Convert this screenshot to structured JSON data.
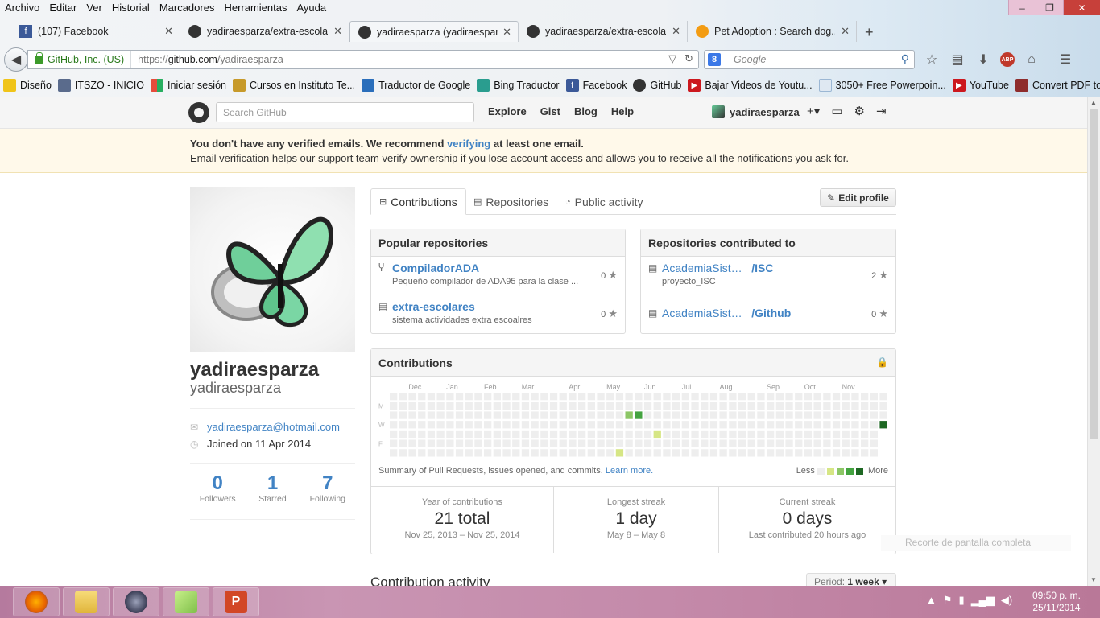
{
  "browser": {
    "menu": [
      "Archivo",
      "Editar",
      "Ver",
      "Historial",
      "Marcadores",
      "Herramientas",
      "Ayuda"
    ],
    "window_controls": [
      "–",
      "❐",
      "✕"
    ],
    "tabs": [
      {
        "title": "(107) Facebook",
        "icon": "facebook-icon",
        "color": "#3b5998"
      },
      {
        "title": "yadiraesparza/extra-escolar...",
        "icon": "github-icon",
        "color": "#333333"
      },
      {
        "title": "yadiraesparza (yadiraesparz...",
        "icon": "github-icon",
        "color": "#333333"
      },
      {
        "title": "yadiraesparza/extra-escolar...",
        "icon": "github-icon",
        "color": "#333333"
      },
      {
        "title": "Pet Adoption : Search dog...",
        "icon": "paw-icon",
        "color": "#f39c12"
      }
    ],
    "url_identity": "GitHub, Inc. (US)",
    "url_prefix": "https://",
    "url_host": "github.com",
    "url_path": "/yadiraesparza",
    "search_placeholder": "Google",
    "bookmarks": [
      {
        "label": "Diseño",
        "icon": "folder-icon",
        "color": "#f0c419"
      },
      {
        "label": "ITSZO - INICIO",
        "icon": "page-icon",
        "color": "#5a6b8c"
      },
      {
        "label": "Iniciar sesión",
        "icon": "windows-icon",
        "color": "#e74c3c"
      },
      {
        "label": "Cursos en Instituto Te...",
        "icon": "school-icon",
        "color": "#c79a2a"
      },
      {
        "label": "Traductor de Google",
        "icon": "translate-icon",
        "color": "#2a6ebb"
      },
      {
        "label": "Bing Traductor",
        "icon": "translate-icon",
        "color": "#2a9d8f"
      },
      {
        "label": "Facebook",
        "icon": "facebook-icon",
        "color": "#3b5998"
      },
      {
        "label": "GitHub",
        "icon": "github-icon",
        "color": "#333333"
      },
      {
        "label": "Bajar Videos de Youtu...",
        "icon": "youtube-icon",
        "color": "#cc181e"
      },
      {
        "label": "3050+ Free Powerpoin...",
        "icon": "page-icon",
        "color": "#9bb7d4"
      },
      {
        "label": "YouTube",
        "icon": "youtube-icon",
        "color": "#cc181e"
      },
      {
        "label": "Convert PDF to Word ...",
        "icon": "convert-icon",
        "color": "#8e2c2c"
      }
    ]
  },
  "github": {
    "search_placeholder": "Search GitHub",
    "nav": [
      "Explore",
      "Gist",
      "Blog",
      "Help"
    ],
    "username": "yadiraesparza",
    "flash": {
      "pre": "You don't have any verified emails. We recommend ",
      "link": "verifying",
      "post": " at least one email.",
      "line2": "Email verification helps our support team verify ownership if you lose account access and allows you to receive all the notifications you ask for."
    },
    "profile": {
      "fullname": "yadiraesparza",
      "username": "yadiraesparza",
      "email": "yadiraesparza@hotmail.com",
      "joined": "Joined on 11 Apr 2014",
      "stats": [
        {
          "num": "0",
          "label": "Followers"
        },
        {
          "num": "1",
          "label": "Starred"
        },
        {
          "num": "7",
          "label": "Following"
        }
      ]
    },
    "tabs": [
      "Contributions",
      "Repositories",
      "Public activity"
    ],
    "edit_profile": "Edit profile",
    "popular": {
      "title": "Popular repositories",
      "items": [
        {
          "name": "CompiladorADA",
          "desc": "Pequeño compilador de ADA95 para la clase ...",
          "stars": "0",
          "icon": "fork-icon"
        },
        {
          "name": "extra-escolares",
          "desc": "sistema actividades extra escoalres",
          "stars": "0",
          "icon": "repo-icon"
        }
      ]
    },
    "contributed": {
      "title": "Repositories contributed to",
      "items": [
        {
          "owner": "AcademiaSist…",
          "name": "/ISC",
          "desc": "proyecto_ISC",
          "stars": "2",
          "icon": "repo-icon"
        },
        {
          "owner": "AcademiaSist…",
          "name": "/Github",
          "desc": "",
          "stars": "0",
          "icon": "repo-icon"
        }
      ]
    },
    "contributions": {
      "title": "Contributions",
      "months": [
        "Dec",
        "Jan",
        "Feb",
        "Mar",
        "Apr",
        "May",
        "Jun",
        "Jul",
        "Aug",
        "Sep",
        "Oct",
        "Nov"
      ],
      "days": [
        "M",
        "W",
        "F"
      ],
      "footer": "Summary of Pull Requests, issues opened, and commits.",
      "learn_more": "Learn more.",
      "less": "Less",
      "more": "More",
      "level_colors": [
        "#eeeeee",
        "#d6e685",
        "#8cc665",
        "#44a340",
        "#1e6823"
      ],
      "active_cells": [
        {
          "week": 25,
          "day": 2,
          "level": 2
        },
        {
          "week": 26,
          "day": 2,
          "level": 3
        },
        {
          "week": 24,
          "day": 6,
          "level": 1
        },
        {
          "week": 28,
          "day": 4,
          "level": 1
        },
        {
          "week": 52,
          "day": 3,
          "level": 4
        }
      ],
      "summary": [
        {
          "title": "Year of contributions",
          "value": "21 total",
          "sub": "Nov 25, 2013 – Nov 25, 2014"
        },
        {
          "title": "Longest streak",
          "value": "1 day",
          "sub": "May 8 – May 8"
        },
        {
          "title": "Current streak",
          "value": "0 days",
          "sub": "Last contributed 20 hours ago"
        }
      ]
    },
    "activity_title": "Contribution activity",
    "period_label": "Period:",
    "period_value": "1 week"
  },
  "overlay_toast": "Recorte de pantalla completa",
  "taskbar": {
    "apps": [
      {
        "name": "firefox",
        "color": "#e66000"
      },
      {
        "name": "file-explorer",
        "color": "#f2c94c"
      },
      {
        "name": "media",
        "color": "#4a4a6a"
      },
      {
        "name": "sticky-notes",
        "color": "#9fd36b"
      },
      {
        "name": "powerpoint",
        "color": "#d24726"
      }
    ],
    "time": "09:50 p. m.",
    "date": "25/11/2014"
  }
}
